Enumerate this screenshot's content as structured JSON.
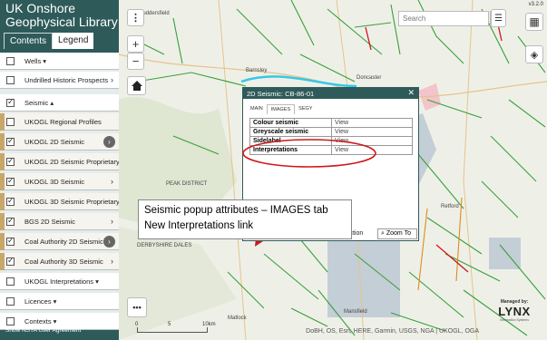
{
  "app": {
    "title_line1": "UK Onshore",
    "title_line2": "Geophysical Library",
    "version": "v3.2.0"
  },
  "tabs": [
    {
      "label": "Contents",
      "active": true
    },
    {
      "label": "Legend",
      "active": false
    }
  ],
  "layers": [
    {
      "label": "Wells ▾",
      "checked": false,
      "type": "top"
    },
    {
      "label": "Undrilled Historic Prospects",
      "checked": false,
      "type": "top",
      "chevron": "›"
    },
    {
      "label": "Seismic ▴",
      "checked": true,
      "type": "top"
    },
    {
      "label": "UKOGL Regional Profiles",
      "checked": false,
      "type": "sub"
    },
    {
      "label": "UKOGL 2D Seismic",
      "checked": true,
      "type": "sub",
      "chevron_circle": "›"
    },
    {
      "label": "UKOGL 2D Seismic Proprietary",
      "checked": true,
      "type": "sub"
    },
    {
      "label": "UKOGL 3D Seismic",
      "checked": true,
      "type": "sub",
      "chevron": "›"
    },
    {
      "label": "UKOGL 3D Seismic Proprietary",
      "checked": true,
      "type": "sub"
    },
    {
      "label": "BGS 2D Seismic",
      "checked": true,
      "type": "sub",
      "chevron": "›"
    },
    {
      "label": "Coal Authority 2D Seismic",
      "checked": true,
      "type": "sub",
      "chevron_circle": "›"
    },
    {
      "label": "Coal Authority 3D Seismic",
      "checked": true,
      "type": "sub",
      "chevron": "›"
    },
    {
      "label": "UKOGL Interpretations ▾",
      "checked": false,
      "type": "top"
    },
    {
      "label": "Licences ▾",
      "checked": false,
      "type": "top"
    },
    {
      "label": "Contexts ▾",
      "checked": false,
      "type": "top"
    }
  ],
  "footer": {
    "user_agreement": "Show NSTA User Agreement"
  },
  "map": {
    "search_placeholder": "Search",
    "places": [
      "Huddersfield",
      "Barnsley",
      "Doncaster",
      "Matlock",
      "Mansfield",
      "Retford",
      "PEAK DISTRICT",
      "DERBYSHIRE DALES"
    ],
    "scale_labels": [
      "0",
      "5",
      "10km"
    ],
    "attribution": "DoBH, OS, Esri, HERE, Garmin, USGS, NGA | UKOGL, OGA",
    "zoom_in": "+",
    "zoom_out": "−",
    "more": "•••"
  },
  "popup": {
    "title": "2D Seismic: CB-86-01",
    "close": "✕",
    "tabs": [
      "MAIN",
      "IMAGES",
      "SEGY"
    ],
    "active_tab": "IMAGES",
    "rows": [
      {
        "key": "Colour seismic",
        "value": "View"
      },
      {
        "key": "Greyscale seismic",
        "value": "View"
      },
      {
        "key": "Sidelabel",
        "value": "View"
      },
      {
        "key": "Interpretations",
        "value": "View"
      }
    ],
    "footer_left": "lection",
    "zoom_to": "Zoom To"
  },
  "callout": {
    "line1": "Seismic popup attributes – IMAGES tab",
    "line2": "New Interpretations link"
  },
  "lynx": {
    "managed_by": "Managed by:",
    "brand": "LYNX",
    "tagline": "Information Systems"
  },
  "colors": {
    "sidebar": "#2f5a5a",
    "seismic_lines": "#3aa03a",
    "highlight": "#36c8e6",
    "annotation": "#d01818"
  }
}
